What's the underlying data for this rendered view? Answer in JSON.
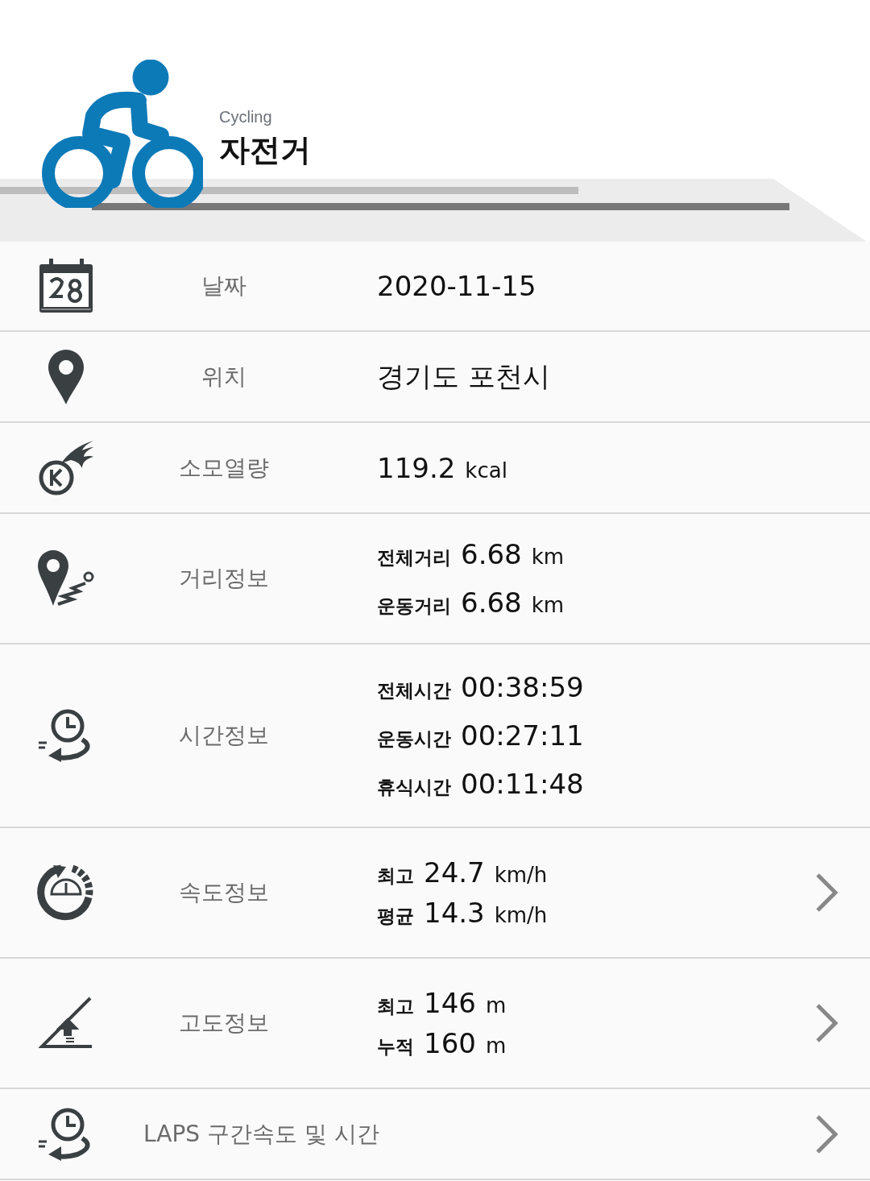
{
  "header": {
    "subtitle": "Cycling",
    "title": "자전거"
  },
  "rows": [
    {
      "kind": "single",
      "label": "날짜",
      "navigable": false,
      "lines": [
        {
          "value": "2020-11-15"
        }
      ]
    },
    {
      "kind": "single",
      "label": "위치",
      "navigable": false,
      "lines": [
        {
          "value": "경기도 포천시"
        }
      ]
    },
    {
      "kind": "single",
      "label": "소모열량",
      "navigable": false,
      "lines": [
        {
          "value": "119.2",
          "unit": "kcal"
        }
      ]
    },
    {
      "kind": "single",
      "label": "거리정보",
      "navigable": false,
      "lines": [
        {
          "label": "전체거리",
          "value": "6.68",
          "unit": "km"
        },
        {
          "label": "운동거리",
          "value": "6.68",
          "unit": "km"
        }
      ]
    },
    {
      "kind": "single",
      "label": "시간정보",
      "navigable": false,
      "lines": [
        {
          "label": "전체시간",
          "value": "00:38:59"
        },
        {
          "label": "운동시간",
          "value": "00:27:11"
        },
        {
          "label": "휴식시간",
          "value": "00:11:48"
        }
      ]
    },
    {
      "kind": "single",
      "label": "속도정보",
      "navigable": true,
      "lines": [
        {
          "label": "최고",
          "value": "24.7",
          "unit": "km/h"
        },
        {
          "label": "평균",
          "value": "14.3",
          "unit": "km/h"
        }
      ]
    },
    {
      "kind": "single",
      "label": "고도정보",
      "navigable": true,
      "lines": [
        {
          "label": "최고",
          "value": "146",
          "unit": "m"
        },
        {
          "label": "누적",
          "value": "160",
          "unit": "m"
        }
      ]
    },
    {
      "kind": "wide",
      "label": "LAPS 구간속도 및 시간",
      "navigable": true,
      "lines": []
    }
  ]
}
